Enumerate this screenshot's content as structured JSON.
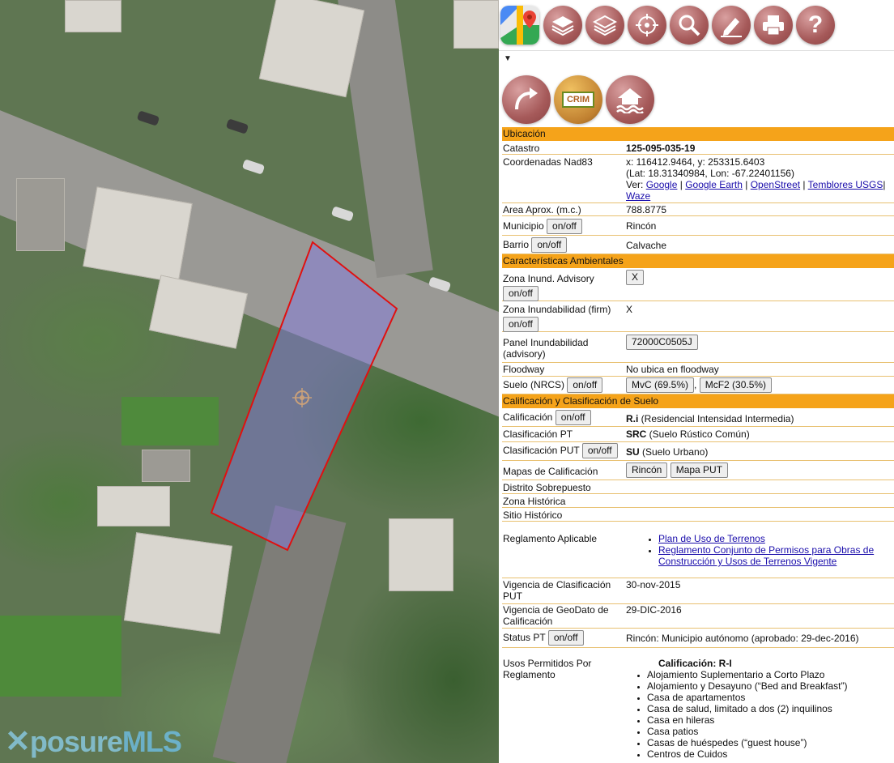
{
  "toolbar": {
    "icons": [
      "google-maps-icon",
      "layers-icon",
      "layers-alt-icon",
      "gps-icon",
      "search-icon",
      "edit-icon",
      "print-icon",
      "help-icon"
    ]
  },
  "panel": {
    "tools": [
      "share-arrow-icon",
      "crim-logo",
      "flood-house-icon"
    ],
    "crim_logo_text": "CRIM",
    "ubicacion": {
      "title": "Ubicación",
      "catastro_label": "Catastro",
      "catastro_value": "125-095-035-19",
      "coord_label": "Coordenadas Nad83",
      "coord_line1": "x: 116412.9464, y: 253315.6403",
      "coord_line2": "(Lat: 18.31340984, Lon: -67.22401156)",
      "ver_label": "Ver:",
      "links": [
        "Google",
        "Google Earth",
        "OpenStreet",
        "Temblores USGS",
        "Waze"
      ],
      "area_label": "Area Aprox. (m.c.)",
      "area_value": "788.8775",
      "municipio_label": "Municipio",
      "municipio_value": "Rincón",
      "barrio_label": "Barrio",
      "barrio_value": "Calvache"
    },
    "ambientales": {
      "title": "Características Ambientales",
      "zona_adv_label": "Zona Inund. Advisory",
      "zona_adv_value": "X",
      "zona_firm_label": "Zona Inundabilidad (firm)",
      "zona_firm_value": "X",
      "panel_label": "Panel Inundabilidad (advisory)",
      "panel_value": "72000C0505J",
      "floodway_label": "Floodway",
      "floodway_value": "No ubica en floodway",
      "suelo_label": "Suelo (NRCS)",
      "suelo_values": [
        "MvC (69.5%)",
        "McF2 (30.5%)"
      ],
      "suelo_sep": ","
    },
    "calificacion": {
      "title": "Calificación y Clasificación de Suelo",
      "calif_label": "Calificación",
      "calif_code": "R.i",
      "calif_desc": " (Residencial Intensidad Intermedia)",
      "pt_label": "Clasificación PT",
      "pt_code": "SRC",
      "pt_desc": " (Suelo Rústico Común)",
      "put_label": "Clasificación PUT",
      "put_code": "SU",
      "put_desc": " (Suelo Urbano)",
      "mapas_label": "Mapas de Calificación",
      "mapas_buttons": [
        "Rincón",
        "Mapa PUT"
      ],
      "distrito_label": "Distrito Sobrepuesto",
      "zona_hist_label": "Zona Histórica",
      "sitio_hist_label": "Sitio Histórico",
      "reglamento_label": "Reglamento Aplicable",
      "reglamento_links": [
        "Plan de Uso de Terrenos",
        "Reglamento Conjunto de Permisos para Obras de Construcción y Usos de Terrenos Vigente"
      ],
      "vig_put_label": "Vigencia de Clasificación PUT",
      "vig_put_value": "30-nov-2015",
      "vig_geo_label": "Vigencia de GeoDato de Calificación",
      "vig_geo_value": "29-DIC-2016",
      "status_label": "Status PT",
      "status_value": "Rincón: Municipio autónomo (aprobado: 29-dec-2016)",
      "usos_label": "Usos Permitidos Por Reglamento",
      "usos_title": "Calificación: R-I",
      "usos": [
        "Alojamiento Suplementario a Corto Plazo",
        "Alojamiento y Desayuno (“Bed and Breakfast”)",
        "Casa de apartamentos",
        "Casa de salud, limitado a dos (2) inquilinos",
        "Casa en hileras",
        "Casa patios",
        "Casas de huéspedes (“guest house”)",
        "Centros de Cuidos"
      ]
    },
    "onoff_label": "on/off"
  },
  "watermark": {
    "part1": "posure",
    "part2": "MLS"
  }
}
